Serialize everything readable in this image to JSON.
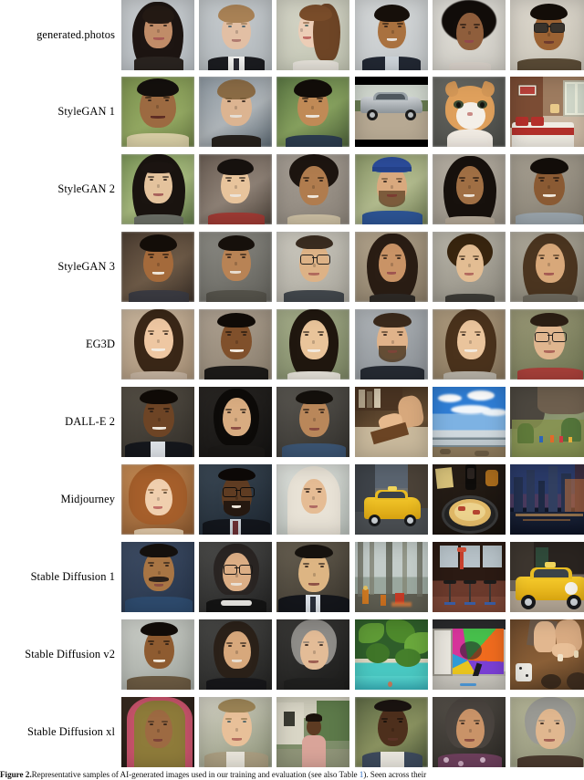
{
  "figure": {
    "title": "Representative samples of AI-generated images",
    "columns": 6,
    "rows": [
      {
        "label": "generated.photos",
        "samples": [
          {
            "name": "smiling-woman-dark-hair-portrait",
            "kind": "face"
          },
          {
            "name": "man-in-suit-portrait",
            "kind": "face"
          },
          {
            "name": "woman-profile-view-portrait",
            "kind": "face"
          },
          {
            "name": "man-dark-suit-portrait",
            "kind": "face"
          },
          {
            "name": "woman-curly-hair-portrait",
            "kind": "face"
          },
          {
            "name": "man-with-sunglasses-portrait",
            "kind": "face"
          }
        ]
      },
      {
        "label": "StyleGAN 1",
        "samples": [
          {
            "name": "smiling-man-outdoors-portrait",
            "kind": "face"
          },
          {
            "name": "woman-short-hair-portrait",
            "kind": "face"
          },
          {
            "name": "smiling-young-man-portrait",
            "kind": "face"
          },
          {
            "name": "silver-car-on-gravel",
            "kind": "car"
          },
          {
            "name": "orange-white-cat",
            "kind": "cat"
          },
          {
            "name": "hotel-bedroom-interior",
            "kind": "bedroom"
          }
        ]
      },
      {
        "label": "StyleGAN 2",
        "samples": [
          {
            "name": "young-girl-bangs-portrait",
            "kind": "face"
          },
          {
            "name": "young-boy-red-shirt-portrait",
            "kind": "face"
          },
          {
            "name": "woman-short-curly-hair-portrait",
            "kind": "face"
          },
          {
            "name": "bearded-man-blue-bandana-portrait",
            "kind": "face"
          },
          {
            "name": "smiling-woman-dark-hair-portrait",
            "kind": "face"
          },
          {
            "name": "smiling-man-grey-shirt-portrait",
            "kind": "face"
          }
        ]
      },
      {
        "label": "StyleGAN 3",
        "samples": [
          {
            "name": "smiling-young-man-portrait",
            "kind": "face"
          },
          {
            "name": "man-short-hair-portrait",
            "kind": "face"
          },
          {
            "name": "man-with-glasses-portrait",
            "kind": "face"
          },
          {
            "name": "woman-dark-hair-portrait",
            "kind": "face"
          },
          {
            "name": "child-curly-hair-portrait",
            "kind": "face"
          },
          {
            "name": "woman-long-hair-portrait",
            "kind": "face"
          }
        ]
      },
      {
        "label": "EG3D",
        "samples": [
          {
            "name": "smiling-girl-portrait",
            "kind": "face"
          },
          {
            "name": "smiling-man-dark-jacket-portrait",
            "kind": "face"
          },
          {
            "name": "smiling-woman-portrait",
            "kind": "face"
          },
          {
            "name": "bearded-man-portrait",
            "kind": "face"
          },
          {
            "name": "smiling-woman-brown-hair-portrait",
            "kind": "face"
          },
          {
            "name": "man-with-glasses-portrait",
            "kind": "face"
          }
        ]
      },
      {
        "label": "DALL-E 2",
        "samples": [
          {
            "name": "smiling-man-dark-suit-portrait",
            "kind": "face"
          },
          {
            "name": "older-woman-dark-background-portrait",
            "kind": "face"
          },
          {
            "name": "man-blue-shirt-portrait",
            "kind": "face"
          },
          {
            "name": "hands-woodworking-on-bench",
            "kind": "workshop"
          },
          {
            "name": "beach-with-blue-sky-and-clouds",
            "kind": "sky"
          },
          {
            "name": "rocky-hillside-with-hikers",
            "kind": "hillside"
          }
        ]
      },
      {
        "label": "Midjourney",
        "samples": [
          {
            "name": "young-girl-curly-hair-portrait",
            "kind": "face"
          },
          {
            "name": "man-with-beard-and-glasses-portrait",
            "kind": "face"
          },
          {
            "name": "woman-with-headscarf-portrait",
            "kind": "face"
          },
          {
            "name": "yellow-taxi-on-city-street",
            "kind": "taxi"
          },
          {
            "name": "pasta-dish-in-pan",
            "kind": "food"
          },
          {
            "name": "futuristic-city-skyline-at-night",
            "kind": "city"
          }
        ]
      },
      {
        "label": "Stable Diffusion 1",
        "samples": [
          {
            "name": "man-with-moustache-portrait",
            "kind": "face"
          },
          {
            "name": "smiling-woman-glasses-portrait",
            "kind": "face"
          },
          {
            "name": "older-man-dark-suit-portrait",
            "kind": "face"
          },
          {
            "name": "firefighters-in-foggy-forest",
            "kind": "forest"
          },
          {
            "name": "bar-interior-with-stools",
            "kind": "bar"
          },
          {
            "name": "yellow-taxi-cab",
            "kind": "taxi2"
          }
        ]
      },
      {
        "label": "Stable Diffusion v2",
        "samples": [
          {
            "name": "smiling-young-man-portrait",
            "kind": "face"
          },
          {
            "name": "smiling-woman-dark-top-portrait",
            "kind": "face"
          },
          {
            "name": "older-woman-grey-hair-portrait",
            "kind": "face"
          },
          {
            "name": "tropical-pool-with-palm-trees",
            "kind": "pool"
          },
          {
            "name": "colorful-mural-skate-ramp",
            "kind": "mural"
          },
          {
            "name": "hands-playing-board-game",
            "kind": "boardgame"
          }
        ]
      },
      {
        "label": "Stable Diffusion xl",
        "samples": [
          {
            "name": "older-woman-in-sari-portrait",
            "kind": "face"
          },
          {
            "name": "young-man-portrait",
            "kind": "face"
          },
          {
            "name": "young-woman-standing-outdoors",
            "kind": "face"
          },
          {
            "name": "young-man-white-shirt-portrait",
            "kind": "face"
          },
          {
            "name": "older-woman-floral-top-portrait",
            "kind": "face"
          },
          {
            "name": "older-woman-grey-hair-portrait",
            "kind": "face"
          }
        ]
      }
    ]
  },
  "caption": {
    "number": "2",
    "prefix": "Figure 2.",
    "text_before_link": "Representative samples of AI-generated images used in our training and evaluation (see also Table ",
    "link": "1",
    "text_after_link": "). Seen across their",
    "full": "Figure 2. Representative samples of AI-generated images used in our training and evaluation (see also Table 1). Seen across their"
  },
  "colors": {
    "page_background": "#ffffff",
    "text": "#000000",
    "link": "#2b6cc4",
    "cell_placeholder": "#cfcfcf"
  }
}
